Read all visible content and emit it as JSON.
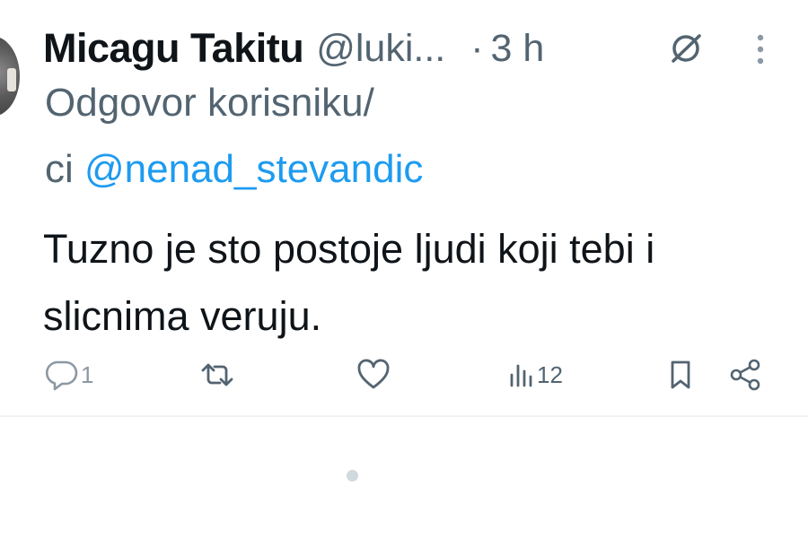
{
  "tweet": {
    "display_name": "Micagu Takitu",
    "handle": "@luki...",
    "separator": "·",
    "time": "3 h",
    "reply_prefix_line1": "Odgovor korisniku/",
    "reply_prefix_line2": "ci ",
    "reply_mention": "@nenad_stevandic",
    "text": "Tuzno je sto postoje ljudi koji tebi i slicnima veruju."
  },
  "actions": {
    "reply_count": "1",
    "retweet_count": "",
    "like_count": "",
    "views_count": "12"
  },
  "icons": {
    "avatar": "avatar",
    "grok": "grok-icon",
    "more": "more-vertical-icon",
    "reply": "reply-icon",
    "retweet": "retweet-icon",
    "like": "heart-icon",
    "views": "views-icon",
    "bookmark": "bookmark-icon",
    "share": "share-icon"
  },
  "colors": {
    "text": "#0f1419",
    "secondary": "#536471",
    "mention": "#1d9bf0",
    "divider": "#eff3f4"
  }
}
